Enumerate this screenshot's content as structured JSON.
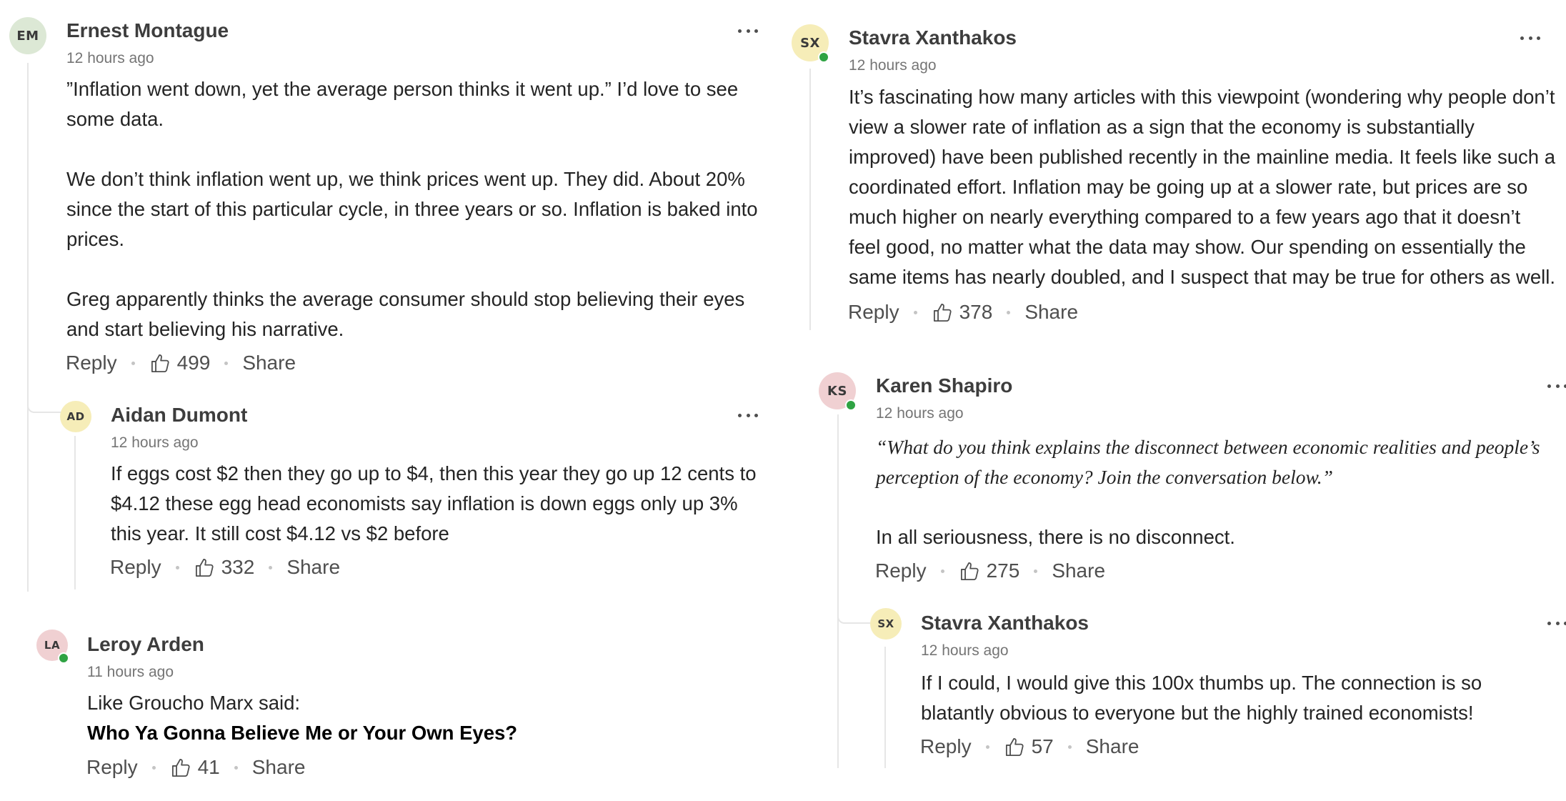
{
  "comments": {
    "ernest": {
      "initials": "EM",
      "author": "Ernest Montague",
      "time": "12 hours ago",
      "paragraphs": [
        "”Inflation went down, yet the average person thinks it went up.” I’d love to see some data.",
        "We don’t think inflation went up, we think prices went up. They did. About 20% since the start of this particular cycle, in three years or so.  Inflation is baked into prices.",
        "Greg apparently thinks the average consumer should stop believing their eyes and start believing his narrative."
      ],
      "reply": "Reply",
      "claps": "499",
      "share": "Share",
      "avatar_color": "#dce8d5"
    },
    "aidan": {
      "initials": "AD",
      "author": "Aidan Dumont",
      "time": "12 hours ago",
      "paragraphs": [
        "If eggs cost $2 then they go up to $4, then this year they go up 12 cents to $4.12 these egg head economists say inflation is down eggs only up 3% this year. It still cost $4.12 vs $2 before"
      ],
      "reply": "Reply",
      "claps": "332",
      "share": "Share",
      "avatar_color": "#f6edb8"
    },
    "leroy": {
      "initials": "LA",
      "author": "Leroy Arden",
      "time": "11 hours ago",
      "line1": "Like Groucho Marx said:",
      "line2": "Who Ya Gonna Believe Me or Your Own Eyes?",
      "reply": "Reply",
      "claps": "41",
      "share": "Share",
      "avatar_color": "#f0d0d2"
    },
    "stavra": {
      "initials": "SX",
      "author": "Stavra Xanthakos",
      "time": "12 hours ago",
      "paragraphs": [
        "It’s fascinating how many articles with this viewpoint (wondering why people don’t view a slower rate of inflation as a sign that the economy is substantially improved) have been published recently in the mainline media. It feels like such a coordinated effort.  Inflation may be going up at a slower rate, but prices are so much higher on nearly everything compared to a few years ago that it doesn’t feel good, no matter what the data may show. Our spending on essentially the same items has nearly doubled, and I suspect that may be true for others as well."
      ],
      "reply": "Reply",
      "claps": "378",
      "share": "Share",
      "avatar_color": "#f6edb8"
    },
    "karen": {
      "initials": "KS",
      "author": "Karen Shapiro",
      "time": "12 hours ago",
      "quote": "“What do you think explains the disconnect between economic realities and people’s perception of the economy? Join the conversation below.”",
      "text": "In all seriousness, there is no disconnect.",
      "reply": "Reply",
      "claps": "275",
      "share": "Share",
      "avatar_color": "#f0d0d2"
    },
    "stavra_reply": {
      "initials": "SX",
      "author": "Stavra Xanthakos",
      "time": "12 hours ago",
      "paragraphs": [
        "If I could, I would give this 100x thumbs up. The connection is so blatantly obvious to everyone but the highly trained economists!"
      ],
      "reply": "Reply",
      "claps": "57",
      "share": "Share",
      "avatar_color": "#f6edb8"
    }
  },
  "icons": {
    "more": "more-options-icon",
    "clap": "thumbs-up-icon",
    "online": "online-status-icon"
  },
  "colors": {
    "online": "#2fa343",
    "thread_line": "#e6e6e6"
  }
}
